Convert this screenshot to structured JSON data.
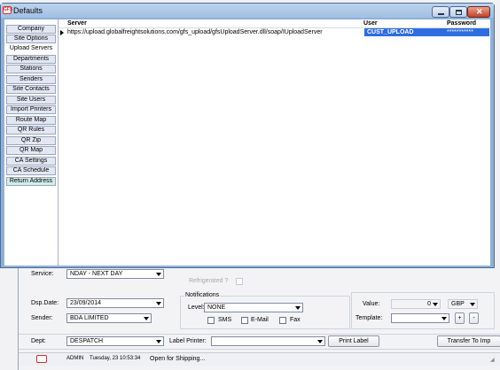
{
  "window": {
    "title": "Defaults",
    "icon": "app-icon"
  },
  "nav": {
    "items": [
      {
        "label": "Company"
      },
      {
        "label": "Site Options"
      },
      {
        "label": "Upload Servers"
      },
      {
        "label": "Departments"
      },
      {
        "label": "Stations"
      },
      {
        "label": "Senders"
      },
      {
        "label": "Site Contacts"
      },
      {
        "label": "Site Users"
      },
      {
        "label": "Import Printers"
      },
      {
        "label": "Route Map"
      },
      {
        "label": "QR Rules"
      },
      {
        "label": "QR Zip"
      },
      {
        "label": "QR Map"
      },
      {
        "label": "CA Settings"
      },
      {
        "label": "CA Schedule"
      },
      {
        "label": "Return Address"
      }
    ]
  },
  "grid": {
    "columns": {
      "server": "Server",
      "user": "User",
      "password": "Password"
    },
    "rows": [
      {
        "server": "https://upload.globalfreightsolutions.com/gfs_upload/gfsUploadServer.dll/soap/IUploadServer",
        "user": "CUST_UPLOAD",
        "password": "***********"
      }
    ]
  },
  "background": {
    "service_label": "Service:",
    "service_value": "NDAY - NEXT DAY",
    "refrigerated_label": "Refrigerated ?",
    "dsp_date_label": "Dsp.Date:",
    "dsp_date_value": "23/09/2014",
    "sender_label": "Sender:",
    "sender_value": "BDA LIMITED",
    "notifications_label": "Notifications",
    "level_label": "Level:",
    "level_value": "NONE",
    "sms_label": "SMS",
    "email_label": "E-Mail",
    "fax_label": "Fax",
    "value_label": "Value:",
    "value_amount": "0",
    "currency": "GBP",
    "template_label": "Template:",
    "plus_label": "+",
    "minus_label": "-",
    "dept_label": "Dept:",
    "dept_value": "DESPATCH",
    "label_printer_label": "Label Printer:",
    "label_printer_value": "",
    "print_label_button": "Print Label",
    "transfer_button": "Transfer To Imp"
  },
  "status": {
    "user": "ADMIN",
    "datetime": "Tuesday, 23 10:53:34",
    "message": "Open for Shipping..."
  }
}
